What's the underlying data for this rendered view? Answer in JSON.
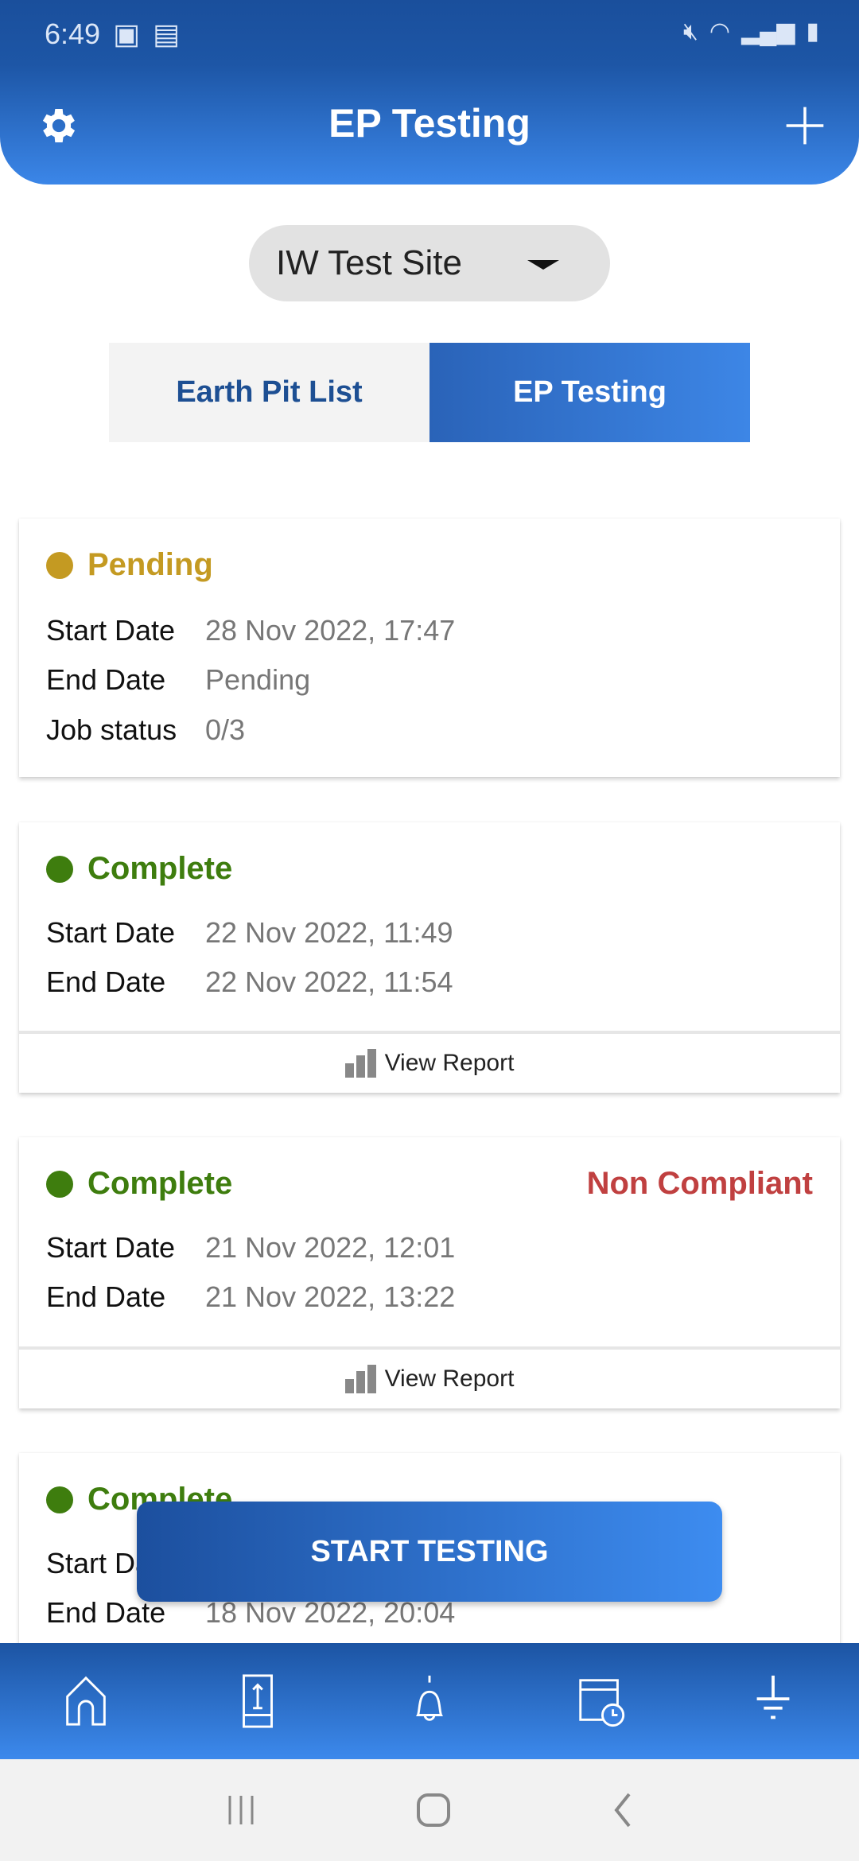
{
  "status_bar": {
    "time": "6:49",
    "icons": [
      "image-icon",
      "clipboard-check-icon",
      "mute-icon",
      "wifi-icon",
      "signal-icon",
      "battery-charging-icon"
    ]
  },
  "header": {
    "title": "EP Testing",
    "left_icon": "gear-icon",
    "right_icon": "plus-icon"
  },
  "site_selector": {
    "value": "IW Test Site"
  },
  "tabs": [
    {
      "label": "Earth Pit List",
      "active": false
    },
    {
      "label": "EP Testing",
      "active": true
    }
  ],
  "colors": {
    "pending": "#c49a22",
    "complete": "#3e7d0e",
    "non_compliant": "#c04040",
    "accent": "#2f6fcf"
  },
  "labels": {
    "start": "Start Date",
    "end": "End Date",
    "job": "Job status",
    "view_report": "View Report"
  },
  "cards": [
    {
      "status": "Pending",
      "start": "28 Nov 2022, 17:47",
      "end": "Pending",
      "job_status": "0/3"
    },
    {
      "status": "Complete",
      "start": "22 Nov 2022, 11:49",
      "end": "22 Nov 2022, 11:54"
    },
    {
      "status": "Complete",
      "compliance": "Non Compliant",
      "start": "21 Nov 2022, 12:01",
      "end": "21 Nov 2022, 13:22"
    },
    {
      "status": "Complete",
      "end": "18 Nov 2022, 20:04"
    }
  ],
  "start_button": "START TESTING",
  "bottom_nav": [
    "home-icon",
    "upload-device-icon",
    "bell-icon",
    "calendar-clock-icon",
    "earth-ground-icon"
  ]
}
